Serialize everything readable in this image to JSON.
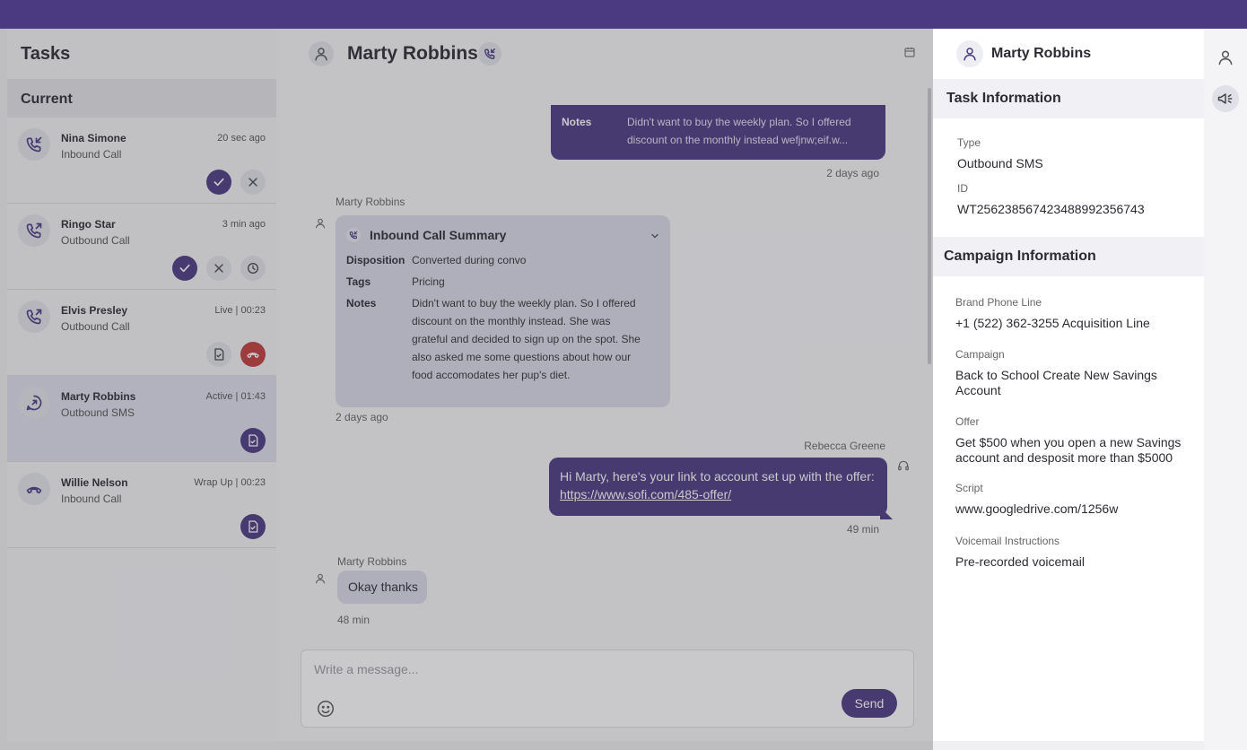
{
  "tasks": {
    "title": "Tasks",
    "section": "Current",
    "items": [
      {
        "name": "Nina Simone",
        "type": "Inbound Call",
        "time": "20 sec ago",
        "icon": "phone-incoming-icon"
      },
      {
        "name": "Ringo Star",
        "type": "Outbound Call",
        "time": "3 min ago",
        "icon": "phone-outgoing-icon"
      },
      {
        "name": "Elvis Presley",
        "type": "Outbound Call",
        "time": "Live | 00:23",
        "icon": "phone-outgoing-icon"
      },
      {
        "name": "Marty Robbins",
        "type": "Outbound SMS",
        "time": "Active | 01:43",
        "icon": "sms-outgoing-icon"
      },
      {
        "name": "Willie Nelson",
        "type": "Inbound Call",
        "time": "Wrap Up | 00:23",
        "icon": "phone-hangup-icon"
      }
    ]
  },
  "chat": {
    "contact": "Marty Robbins",
    "top_message": {
      "notes_label": "Notes",
      "notes_line1": "Didn't want to buy the weekly plan. So I offered",
      "notes_line2": "discount on the monthly instead wefjnw;eif.w...",
      "time": "2 days ago"
    },
    "summary": {
      "sender": "Marty Robbins",
      "title": "Inbound Call Summary",
      "disposition_label": "Disposition",
      "disposition": "Converted during convo",
      "tags_label": "Tags",
      "tags": "Pricing",
      "notes_label": "Notes",
      "notes": [
        "Didn't want to buy the weekly plan. So I offered",
        "discount on the monthly instead. She was",
        "grateful and decided to sign up on the spot. She",
        "also asked me some questions about how our",
        "food accomodates her pup's diet."
      ],
      "time": "2 days ago"
    },
    "link_message": {
      "sender": "Rebecca Greene",
      "text": "Hi Marty, here's your link to account set up with the offer:",
      "link": "https://www.sofi.com/485-offer/",
      "time": "49 min"
    },
    "reply": {
      "sender": "Marty Robbins",
      "text": "Okay thanks",
      "time": "48 min"
    },
    "composer": {
      "placeholder": "Write a message...",
      "send_label": "Send"
    }
  },
  "details": {
    "contact": "Marty Robbins",
    "task_section": "Task Information",
    "type_label": "Type",
    "type": "Outbound SMS",
    "id_label": "ID",
    "id": "WT25623856742348899235674 3",
    "campaign_section": "Campaign Information",
    "brand_label": "Brand Phone Line",
    "brand": "+1 (522) 362-3255  Acquisition Line",
    "campaign_label": "Campaign",
    "campaign_line1": "Back to School Create New Savings",
    "campaign_line2": "Account",
    "offer_label": "Offer",
    "offer_line1": "Get $500 when you open a new Savings",
    "offer_line2": "account and desposit more than $5000",
    "script_label": "Script",
    "script": "www.googledrive.com/1256w",
    "voicemail_label": "Voicemail Instructions",
    "voicemail": "Pre-recorded voicemail"
  },
  "colors": {
    "brand": "#4b3a82",
    "decline": "#c23b3b"
  }
}
